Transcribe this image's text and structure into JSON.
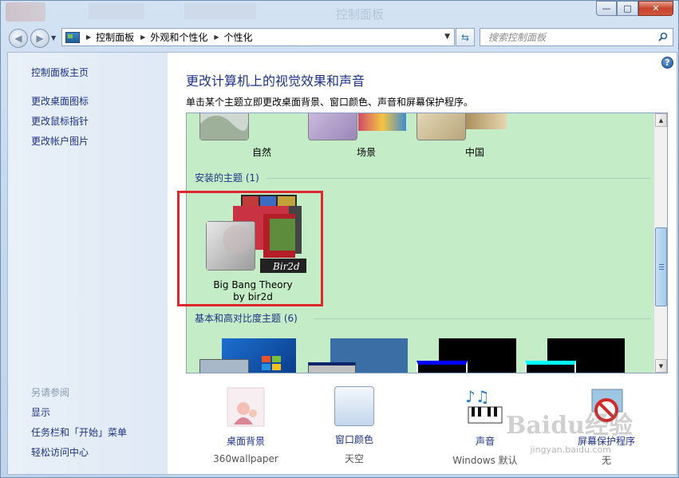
{
  "window": {
    "title_ghost": "控制面板",
    "minimize_label": "—",
    "maximize_label": "□",
    "close_label": "✕"
  },
  "address": {
    "crumbs": [
      "控制面板",
      "外观和个性化",
      "个性化"
    ]
  },
  "search": {
    "placeholder": "搜索控制面板"
  },
  "sidebar": {
    "items": [
      {
        "label": "控制面板主页"
      },
      {
        "label": "更改桌面图标"
      },
      {
        "label": "更改鼠标指针"
      },
      {
        "label": "更改帐户图片"
      }
    ],
    "see_also_heading": "另请参阅",
    "see_also": [
      {
        "label": "显示"
      },
      {
        "label": "任务栏和「开始」菜单"
      },
      {
        "label": "轻松访问中心"
      }
    ]
  },
  "main": {
    "title": "更改计算机上的视觉效果和声音",
    "description": "单击某个主题立即更改桌面背景、窗口颜色、声音和屏幕保护程序。",
    "help": "?"
  },
  "gallery": {
    "aero_themes": [
      {
        "name": "自然"
      },
      {
        "name": "场景"
      },
      {
        "name": "中国"
      }
    ],
    "installed_heading": "安装的主题 (1)",
    "installed_themes": [
      {
        "name": "Big Bang Theory by bir2d",
        "badge": "Bir2d"
      }
    ],
    "basic_heading": "基本和高对比度主题 (6)"
  },
  "bottom": {
    "items": [
      {
        "link": "桌面背景",
        "sub": "360wallpaper"
      },
      {
        "link": "窗口颜色",
        "sub": "天空"
      },
      {
        "link": "声音",
        "sub": "Windows 默认"
      },
      {
        "link": "屏幕保护程序",
        "sub": "无"
      }
    ]
  },
  "watermark": {
    "text": "Baidu经验",
    "sub": "jingyan.baidu.com"
  },
  "colors": {
    "accent": "#1e3287",
    "gallery_bg": "#c4ecc6",
    "highlight": "#e0272d"
  }
}
